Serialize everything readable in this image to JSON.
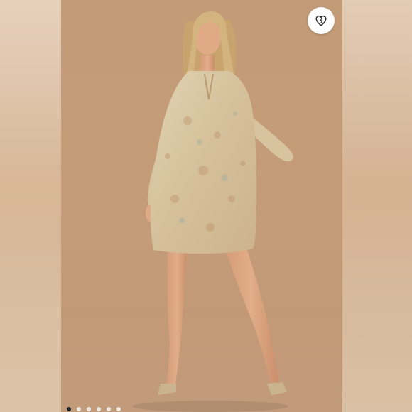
{
  "screen": {
    "title": "",
    "like_button": {
      "icon": "heart-icon",
      "color": "#333333"
    },
    "gallery": {
      "slides_count": 6,
      "active_index": 0
    },
    "colors": {
      "backdrop": "#c49c79",
      "dress": "#d8c6a2"
    }
  }
}
